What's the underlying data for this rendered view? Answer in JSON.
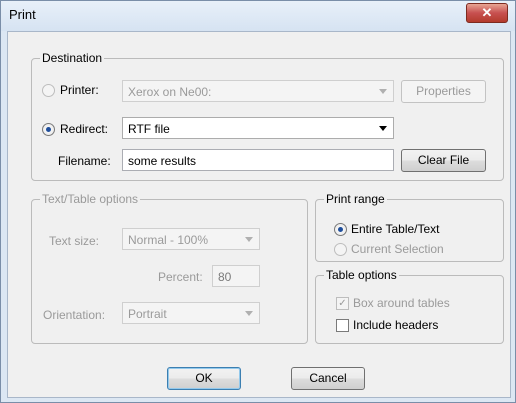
{
  "window": {
    "title": "Print",
    "close_glyph": "✕"
  },
  "destination": {
    "legend": "Destination",
    "printer_label": "Printer:",
    "printer_value": "Xerox on Ne00:",
    "properties_button": "Properties",
    "redirect_label": "Redirect:",
    "redirect_value": "RTF file",
    "filename_label": "Filename:",
    "filename_value": "some results",
    "clear_file_button": "Clear File",
    "selected": "redirect"
  },
  "text_table_options": {
    "legend": "Text/Table options",
    "text_size_label": "Text size:",
    "text_size_value": "Normal - 100%",
    "percent_label": "Percent:",
    "percent_value": "80",
    "orientation_label": "Orientation:",
    "orientation_value": "Portrait"
  },
  "print_range": {
    "legend": "Print range",
    "entire_label": "Entire Table/Text",
    "current_label": "Current Selection",
    "selected": "entire"
  },
  "table_options": {
    "legend": "Table options",
    "box_label": "Box around tables",
    "box_checked": true,
    "headers_label": "Include headers",
    "headers_checked": false
  },
  "buttons": {
    "ok": "OK",
    "cancel": "Cancel"
  }
}
